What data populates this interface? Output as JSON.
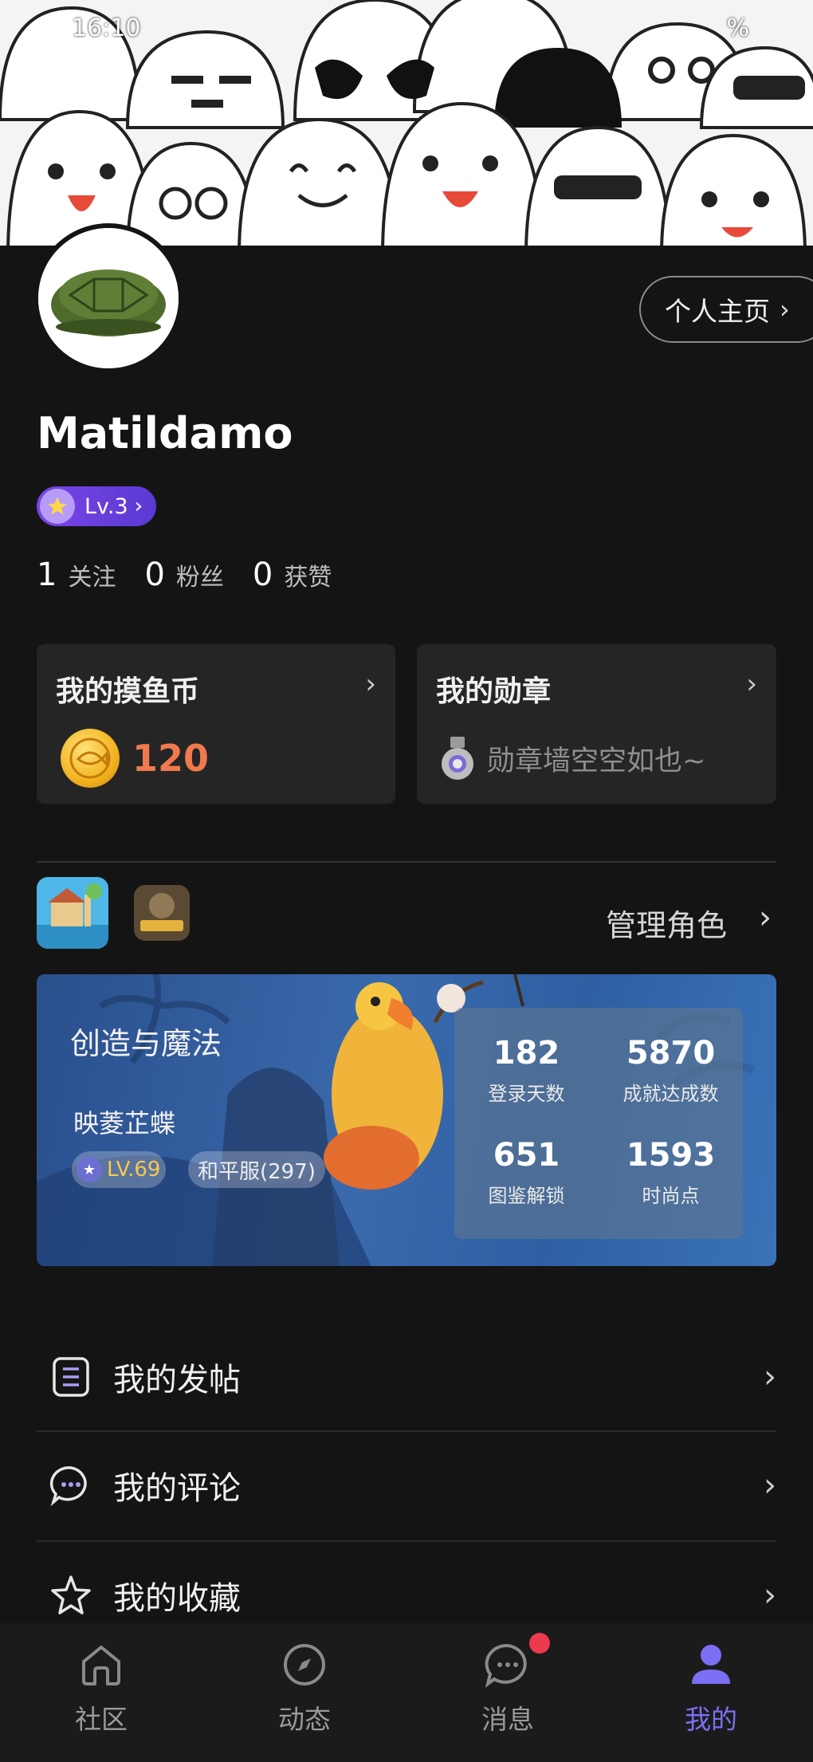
{
  "status_bar": {
    "time": "16:10",
    "battery": "%"
  },
  "profile": {
    "home_button_label": "个人主页",
    "username": "Matildamo",
    "level": "Lv.3",
    "stats": [
      {
        "value": "1",
        "label": "关注"
      },
      {
        "value": "0",
        "label": "粉丝"
      },
      {
        "value": "0",
        "label": "获赞"
      }
    ]
  },
  "cards": {
    "coins": {
      "title": "我的摸鱼币",
      "value": "120"
    },
    "medals": {
      "title": "我的勋章",
      "empty_text": "勋章墙空空如也~"
    }
  },
  "games": {
    "manage_label": "管理角色",
    "featured": {
      "game_name": "创造与魔法",
      "character_name": "映菱芷蝶",
      "level": "LV.69",
      "server": "和平服(297)",
      "stats": [
        {
          "value": "182",
          "label": "登录天数"
        },
        {
          "value": "5870",
          "label": "成就达成数"
        },
        {
          "value": "651",
          "label": "图鉴解锁"
        },
        {
          "value": "1593",
          "label": "时尚点"
        }
      ]
    }
  },
  "menu": [
    {
      "label": "我的发帖",
      "icon": "document-icon"
    },
    {
      "label": "我的评论",
      "icon": "chat-bubble-icon"
    },
    {
      "label": "我的收藏",
      "icon": "star-icon"
    }
  ],
  "nav": [
    {
      "label": "社区",
      "icon": "home-icon"
    },
    {
      "label": "动态",
      "icon": "compass-icon"
    },
    {
      "label": "消息",
      "icon": "message-icon"
    },
    {
      "label": "我的",
      "icon": "profile-icon"
    }
  ],
  "colors": {
    "accent": "#7c6ff4",
    "coin": "#f07a4d",
    "badge_dot": "#ec3a4f"
  }
}
